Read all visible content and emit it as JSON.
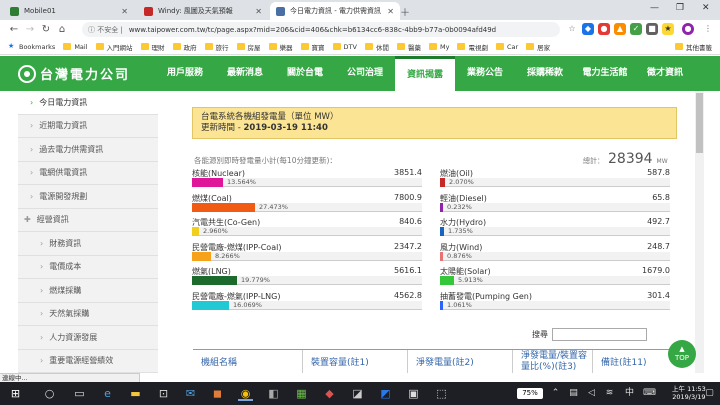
{
  "browser": {
    "tabs": [
      {
        "label": "Mobile01",
        "color": "#2f7d32"
      },
      {
        "label": "Windy: 風圖及天氣預報",
        "color": "#c62828"
      },
      {
        "label": "今日電力資訊 - 電力供需資訊 - 資",
        "color": "#4a6fa5"
      }
    ],
    "address": {
      "security": "不安全",
      "url": "www.taipower.com.tw/tc/page.aspx?mid=206&cid=406&chk=b6134cc6-838c-4bb9-b77a-0b0094afd49d"
    },
    "bookmarks": [
      "Bookmarks",
      "Mail",
      "入門網站",
      "理財",
      "政府",
      "旅行",
      "房屋",
      "樂器",
      "寶寶",
      "DTV",
      "休閒",
      "醫藥",
      "My",
      "電視劇",
      "Car",
      "居家",
      "其他書籤"
    ]
  },
  "site": {
    "logo": "台灣電力公司",
    "nav": [
      "用戶服務",
      "最新消息",
      "關於台電",
      "公司治理",
      "資訊揭露",
      "業務公告",
      "採購稀款",
      "電力生活館",
      "徵才資訊"
    ],
    "active_nav": "資訊揭露"
  },
  "sidebar": {
    "items": [
      {
        "label": "今日電力資訊",
        "kind": "active"
      },
      {
        "label": "近期電力資訊",
        "kind": "normal"
      },
      {
        "label": "過去電力供需資訊",
        "kind": "normal"
      },
      {
        "label": "電網供電資訊",
        "kind": "normal"
      },
      {
        "label": "電源開發規劃",
        "kind": "normal"
      },
      {
        "label": "經營資訊",
        "kind": "parent"
      },
      {
        "label": "財務資訊",
        "kind": "sub"
      },
      {
        "label": "電價成本",
        "kind": "sub"
      },
      {
        "label": "燃煤採購",
        "kind": "sub"
      },
      {
        "label": "天然氣採購",
        "kind": "sub"
      },
      {
        "label": "人力資源發展",
        "kind": "sub"
      },
      {
        "label": "重要電源經營績效",
        "kind": "sub"
      }
    ]
  },
  "notice": {
    "title": "台電系統各機組發電量（單位 MW）",
    "update_label": "更新時間 - ",
    "update_time": "2019-03-19 11:40"
  },
  "summary": {
    "subtitle": "各能源別即時發電量小計(每10分鐘更新)：",
    "total_label": "總計：",
    "total": "28394",
    "unit": "MW"
  },
  "generation": {
    "left": [
      {
        "name": "核能(Nuclear)",
        "value": "3851.4",
        "pct": "13.564%",
        "fraction": 0.13564,
        "color": "#e0169a"
      },
      {
        "name": "燃煤(Coal)",
        "value": "7800.9",
        "pct": "27.473%",
        "fraction": 0.27473,
        "color": "#f05a14"
      },
      {
        "name": "汽電共生(Co-Gen)",
        "value": "840.6",
        "pct": "2.960%",
        "fraction": 0.0296,
        "color": "#f2cf1d"
      },
      {
        "name": "民營電廠-燃煤(IPP-Coal)",
        "value": "2347.2",
        "pct": "8.266%",
        "fraction": 0.08266,
        "color": "#f7a21b"
      },
      {
        "name": "燃氣(LNG)",
        "value": "5616.1",
        "pct": "19.779%",
        "fraction": 0.19779,
        "color": "#1c6a2c"
      },
      {
        "name": "民營電廠-燃氣(IPP-LNG)",
        "value": "4562.8",
        "pct": "16.069%",
        "fraction": 0.16069,
        "color": "#20c9d4"
      }
    ],
    "right": [
      {
        "name": "燃油(Oil)",
        "value": "587.8",
        "pct": "2.070%",
        "fraction": 0.0207,
        "color": "#c62828"
      },
      {
        "name": "輕油(Diesel)",
        "value": "65.8",
        "pct": "0.232%",
        "fraction": 0.00232,
        "color": "#8e24aa"
      },
      {
        "name": "水力(Hydro)",
        "value": "492.7",
        "pct": "1.735%",
        "fraction": 0.01735,
        "color": "#1565c0"
      },
      {
        "name": "風力(Wind)",
        "value": "248.7",
        "pct": "0.876%",
        "fraction": 0.00876,
        "color": "#e57373"
      },
      {
        "name": "太陽能(Solar)",
        "value": "1679.0",
        "pct": "5.913%",
        "fraction": 0.05913,
        "color": "#35c73a"
      },
      {
        "name": "抽蓄發電(Pumping Gen)",
        "value": "301.4",
        "pct": "1.061%",
        "fraction": 0.01061,
        "color": "#2962ff"
      }
    ]
  },
  "table": {
    "search_label": "搜尋",
    "headers": [
      "機組名稱",
      "裝置容量(註1)",
      "淨發電量(註2)",
      "淨發電量/裝置容量比(%)(註3)",
      "備註(註11)"
    ]
  },
  "topbtn": {
    "arrow": "▲",
    "label": "TOP"
  },
  "status_text": "連線中...",
  "taskbar": {
    "battery": "75%",
    "time": "上午 11:53",
    "date": "2019/3/19"
  }
}
